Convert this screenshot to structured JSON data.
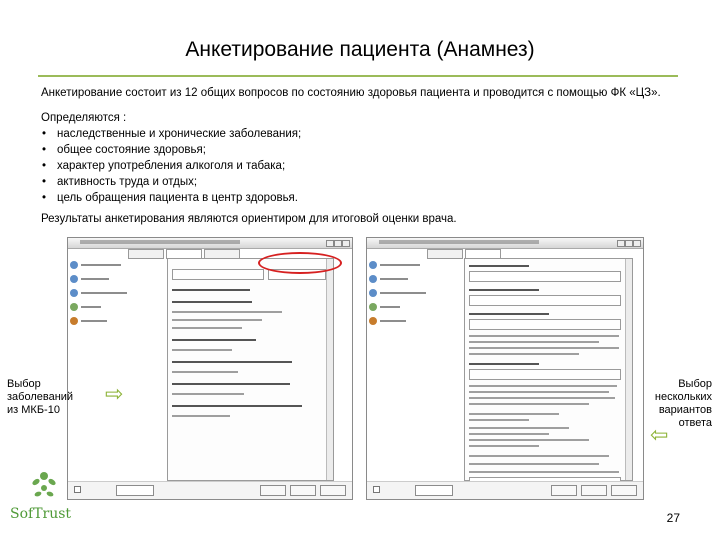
{
  "title": "Анкетирование пациента (Анамнез)",
  "intro": "Анкетирование состоит из 12 общих вопросов по состоянию здоровья пациента и проводится с помощью ФК «ЦЗ».",
  "determined_label": "Определяются :",
  "determined_items": [
    "наследственные и хронические заболевания;",
    "общее состояние здоровья;",
    "характер употребления алкоголя и табака;",
    "активность труда и отдых;",
    "цель обращения пациента в центр здоровья."
  ],
  "results_text": "Результаты анкетирования являются ориентиром для итоговой оценки врача.",
  "left_caption": {
    "line1": "Выбор",
    "line2": "заболеваний",
    "line3": "из МКБ-10"
  },
  "right_caption": {
    "line1": "Выбор",
    "line2": "нескольких",
    "line3": "вариантов",
    "line4": "ответа"
  },
  "logo": {
    "text": "SofTrust"
  },
  "page_number": "27",
  "colors": {
    "accent": "#9bbb59",
    "arrow": "#8db337",
    "highlight": "#d62020"
  },
  "icons": {
    "arrow_right": "arrow-right-icon",
    "arrow_left": "arrow-left-icon"
  }
}
